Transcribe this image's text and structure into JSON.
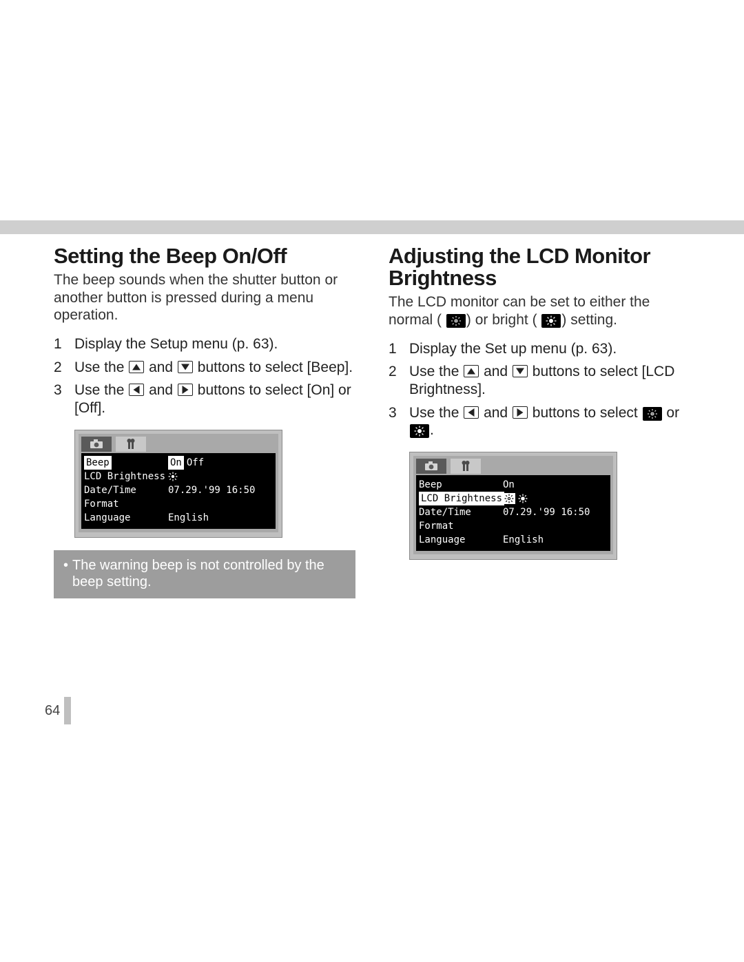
{
  "page_number": "64",
  "common": {
    "and": " and "
  },
  "left": {
    "heading": "Setting the Beep On/Off",
    "intro": "The beep sounds when the shutter button or another button is pressed during a menu operation.",
    "steps": [
      "Display the Setup menu (p. 63)."
    ],
    "step2": {
      "a": "Use the ",
      "b": " buttons to select [Beep]."
    },
    "step3": {
      "a": "Use the ",
      "b": " buttons to select [On] or [Off]."
    },
    "note": "The warning beep is not controlled by the beep setting."
  },
  "right": {
    "heading": "Adjusting the LCD Monitor Brightness",
    "intro": {
      "a": "The LCD monitor can be set to either the normal (",
      "b": ") or bright (",
      "c": ") setting."
    },
    "steps": [
      "Display the Set up menu (p. 63)."
    ],
    "step2": {
      "a": "Use the ",
      "b": " buttons to select [LCD Brightness]."
    },
    "step3": {
      "a": "Use the ",
      "b": " buttons to select ",
      "c": " or ",
      "d": "."
    }
  },
  "lcd": {
    "rows": [
      {
        "label": "Beep"
      },
      {
        "label": "LCD Brightness"
      },
      {
        "label": "Date/Time"
      },
      {
        "label": "Format"
      },
      {
        "label": "Language"
      }
    ],
    "beep_on": "On",
    "beep_off": "Off",
    "datetime": "07.29.'99 16:50",
    "language": "English"
  }
}
